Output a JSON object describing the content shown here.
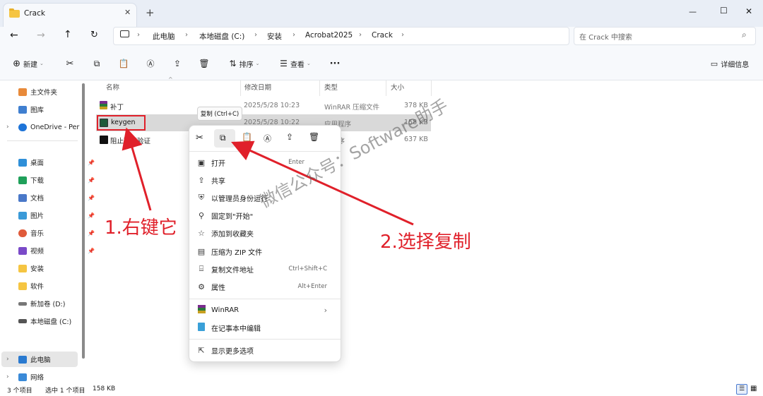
{
  "window": {
    "tab_title": "Crack",
    "new_tab": "+",
    "minimize": "—",
    "maximize": "☐",
    "close": "✕"
  },
  "address": {
    "crumbs": [
      "此电脑",
      "本地磁盘 (C:)",
      "安装",
      "Acrobat2025",
      "Crack"
    ],
    "search_placeholder": "在 Crack 中搜索"
  },
  "toolbar": {
    "new_label": "新建",
    "sort_label": "排序",
    "view_label": "查看",
    "more": "···",
    "details_label": "详细信息"
  },
  "sidebar": {
    "items": [
      "主文件夹",
      "图库",
      "OneDrive - Per",
      "桌面",
      "下载",
      "文档",
      "图片",
      "音乐",
      "视频",
      "安装",
      "软件",
      "新加卷 (D:)",
      "本地磁盘 (C:)",
      "此电脑",
      "网络"
    ]
  },
  "columns": {
    "name": "名称",
    "date": "修改日期",
    "type": "类型",
    "size": "大小"
  },
  "files": [
    {
      "name": "补丁",
      "date": "2025/5/28 10:23",
      "type": "WinRAR 压缩文件",
      "size": "378 KB"
    },
    {
      "name": "keygen",
      "date": "2025/5/28 10:22",
      "type": "应用程序",
      "size": "158 KB"
    },
    {
      "name": "阻止联网验证",
      "date": "",
      "type": "程序",
      "size": "637 KB"
    }
  ],
  "tooltip": "复制 (Ctrl+C)",
  "context_menu": {
    "items": [
      {
        "label": "打开",
        "shortcut": "Enter"
      },
      {
        "label": "共享",
        "shortcut": ""
      },
      {
        "label": "以管理员身份运行",
        "shortcut": ""
      },
      {
        "label": "固定到\"开始\"",
        "shortcut": ""
      },
      {
        "label": "添加到收藏夹",
        "shortcut": ""
      },
      {
        "label": "压缩为 ZIP 文件",
        "shortcut": ""
      },
      {
        "label": "复制文件地址",
        "shortcut": "Ctrl+Shift+C"
      },
      {
        "label": "属性",
        "shortcut": "Alt+Enter"
      }
    ],
    "submenu": [
      {
        "label": "WinRAR"
      },
      {
        "label": "在记事本中编辑"
      }
    ],
    "more": "显示更多选项"
  },
  "annotations": {
    "step1": "1.右键它",
    "step2": "2.选择复制",
    "watermark": "微信公众号：Software助手",
    "colors": {
      "red": "#e0202a"
    }
  },
  "statusbar": {
    "count": "3 个项目",
    "selected": "选中 1 个项目",
    "size": "158 KB"
  }
}
